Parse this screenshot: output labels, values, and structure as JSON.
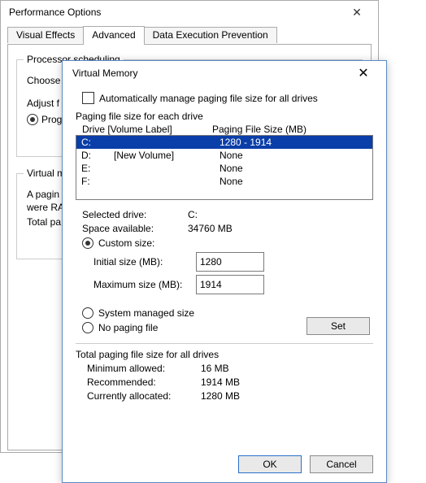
{
  "bg": {
    "title": "Performance Options",
    "tabs": {
      "visual": "Visual Effects",
      "advanced": "Advanced",
      "dep": "Data Execution Prevention"
    },
    "group1_label": "Processor scheduling",
    "choose_text": "Choose",
    "adjust_text": "Adjust f",
    "radio_prog": "Prog",
    "group2_label": "Virtual m",
    "paging_text": "A pagin",
    "were_text": "were RA",
    "total_text": "Total pa"
  },
  "vm": {
    "title": "Virtual Memory",
    "auto_checkbox": "Automatically manage paging file size for all drives",
    "each_drive_label": "Paging file size for each drive",
    "header_drive": "Drive  [Volume Label]",
    "header_size": "Paging File Size (MB)",
    "drives": [
      {
        "letter": "C:",
        "label": "",
        "size": "1280 - 1914",
        "selected": true
      },
      {
        "letter": "D:",
        "label": "[New Volume]",
        "size": "None",
        "selected": false
      },
      {
        "letter": "E:",
        "label": "",
        "size": "None",
        "selected": false
      },
      {
        "letter": "F:",
        "label": "",
        "size": "None",
        "selected": false
      }
    ],
    "selected_drive_label": "Selected drive:",
    "selected_drive_value": "C:",
    "space_label": "Space available:",
    "space_value": "34760 MB",
    "radio_custom": "Custom size:",
    "initial_label": "Initial size (MB):",
    "initial_value": "1280",
    "max_label": "Maximum size (MB):",
    "max_value": "1914",
    "radio_system": "System managed size",
    "radio_none": "No paging file",
    "set_button": "Set",
    "totals_label": "Total paging file size for all drives",
    "min_label": "Minimum allowed:",
    "min_value": "16 MB",
    "rec_label": "Recommended:",
    "rec_value": "1914 MB",
    "cur_label": "Currently allocated:",
    "cur_value": "1280 MB",
    "ok": "OK",
    "cancel": "Cancel"
  }
}
